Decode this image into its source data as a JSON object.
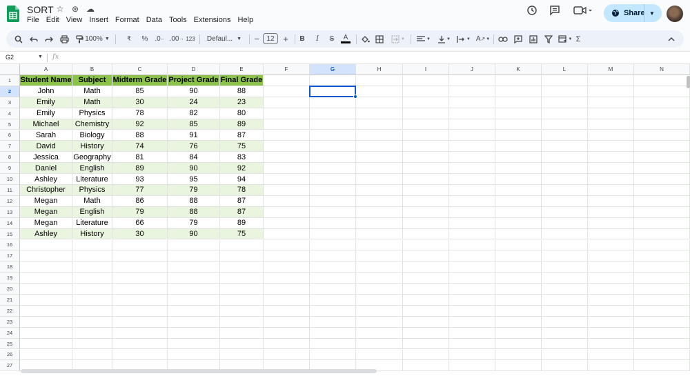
{
  "app": {
    "title": "SORT",
    "menu": [
      "File",
      "Edit",
      "View",
      "Insert",
      "Format",
      "Data",
      "Tools",
      "Extensions",
      "Help"
    ],
    "share_label": "Share",
    "accent": "#0b57d0",
    "brand_green": "#0f9d58"
  },
  "toolbar": {
    "zoom": "100%",
    "currency": "₹",
    "percent": "%",
    "decrease_decimal": ".0",
    "increase_decimal": ".00",
    "number_format": "123",
    "font": "Defaul...",
    "font_size": "12",
    "minus": "−",
    "plus": "+",
    "bold": "B",
    "italic": "I",
    "strike": "S",
    "text_color": "A",
    "sigma": "Σ"
  },
  "formula_bar": {
    "name_box": "G2",
    "fx": "fx",
    "value": ""
  },
  "grid": {
    "columns": [
      "A",
      "B",
      "C",
      "D",
      "E",
      "F",
      "G",
      "H",
      "I",
      "J",
      "K",
      "L",
      "M",
      "N"
    ],
    "row_count": 27,
    "selected_column": "G",
    "selected_row": 2,
    "header_color": "#8bc34a",
    "alt_row_color": "#eaf5df",
    "headers": [
      "Student Name",
      "Subject",
      "Midterm Grade",
      "Project Grade",
      "Final Grade"
    ],
    "rows": [
      [
        "John",
        "Math",
        "85",
        "90",
        "88"
      ],
      [
        "Emily",
        "Math",
        "30",
        "24",
        "23"
      ],
      [
        "Emily",
        "Physics",
        "78",
        "82",
        "80"
      ],
      [
        "Michael",
        "Chemistry",
        "92",
        "85",
        "89"
      ],
      [
        "Sarah",
        "Biology",
        "88",
        "91",
        "87"
      ],
      [
        "David",
        "History",
        "74",
        "76",
        "75"
      ],
      [
        "Jessica",
        "Geography",
        "81",
        "84",
        "83"
      ],
      [
        "Daniel",
        "English",
        "89",
        "90",
        "92"
      ],
      [
        "Ashley",
        "Literature",
        "93",
        "95",
        "94"
      ],
      [
        "Christopher",
        "Physics",
        "77",
        "79",
        "78"
      ],
      [
        "Megan",
        "Math",
        "86",
        "88",
        "87"
      ],
      [
        "Megan",
        "English",
        "79",
        "88",
        "87"
      ],
      [
        "Megan",
        "Literature",
        "66",
        "79",
        "89"
      ],
      [
        "Ashley",
        "History",
        "30",
        "90",
        "75"
      ]
    ]
  },
  "icons": [
    "search-icon",
    "undo-icon",
    "redo-icon",
    "print-icon",
    "paint-format-icon",
    "star-icon",
    "move-icon",
    "cloud-icon",
    "history-icon",
    "comment-icon",
    "meet-icon",
    "globe-icon",
    "fill-color-icon",
    "borders-icon",
    "merge-icon",
    "align-icon",
    "valign-icon",
    "wrap-icon",
    "rotate-icon",
    "link-icon",
    "insert-comment-icon",
    "chart-icon",
    "filter-icon",
    "filter-views-icon",
    "collapse-icon"
  ]
}
